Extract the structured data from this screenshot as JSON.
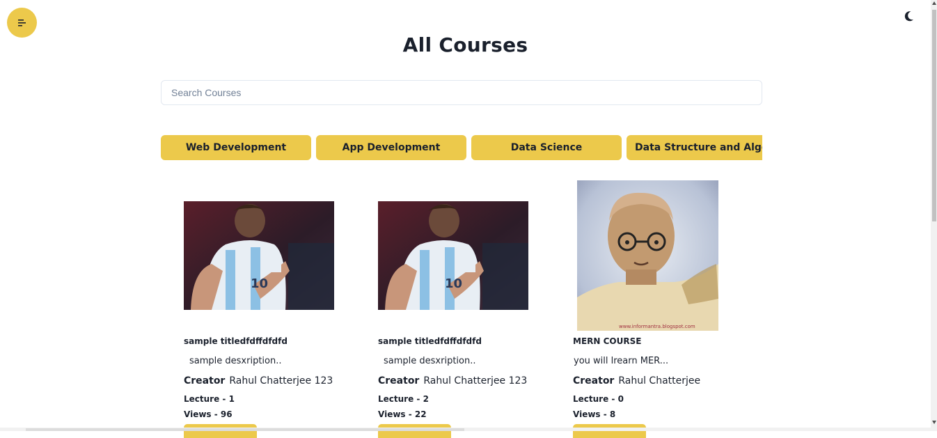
{
  "header": {
    "menu_icon": "hamburger-left-icon",
    "theme_icon": "moon-icon",
    "title": "All Courses"
  },
  "search": {
    "placeholder": "Search Courses",
    "value": ""
  },
  "categories": [
    "Web Development",
    "App Development",
    "Data Science",
    "Data Structure and Algorithm"
  ],
  "courses": [
    {
      "image": "football-player-photo",
      "title": "sample titledfdffdfdfd",
      "description": "sample desxription..",
      "creator_label": "Creator",
      "creator": "Rahul Chatterjee 123",
      "lectures": "Lecture - 1",
      "views": "Views - 96"
    },
    {
      "image": "football-player-photo",
      "title": "sample titledfdffdfdfd",
      "description": "sample desxription..",
      "creator_label": "Creator",
      "creator": "Rahul Chatterjee 123",
      "lectures": "Lecture - 2",
      "views": "Views - 22"
    },
    {
      "image": "portrait-photo",
      "title": "MERN COURSE",
      "description": "you will lrearn MER...",
      "creator_label": "Creator",
      "creator": "Rahul Chatterjee",
      "lectures": "Lecture - 0",
      "views": "Views - 8"
    }
  ],
  "colors": {
    "accent": "#ecc94b",
    "text": "#1a202c",
    "border": "#e2e8f0"
  }
}
